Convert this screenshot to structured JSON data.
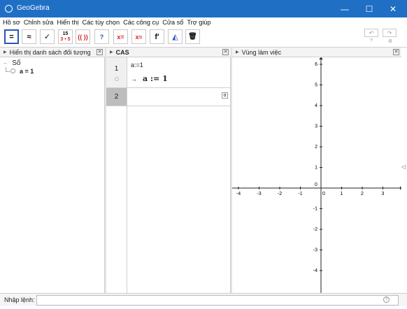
{
  "window": {
    "title": "GeoGebra",
    "minimize": "—",
    "maximize": "☐",
    "close": "✕"
  },
  "menu": [
    "Hồ sơ",
    "Chỉnh sửa",
    "Hiển thị",
    "Các tùy chọn",
    "Các công cụ",
    "Cửa sổ",
    "Trợ giúp"
  ],
  "toolbar": {
    "tools": [
      {
        "name": "evaluate-tool",
        "label": "="
      },
      {
        "name": "numeric-tool",
        "label": "≈"
      },
      {
        "name": "keep-input-tool",
        "label": "✓"
      },
      {
        "name": "factor-tool",
        "label": "15"
      },
      {
        "name": "expand-tool",
        "label": "(( ))"
      },
      {
        "name": "substitute-tool",
        "label": "?"
      },
      {
        "name": "solve-tool",
        "label": "x="
      },
      {
        "name": "solve-numeric-tool",
        "label": "x≈"
      },
      {
        "name": "derivative-tool",
        "label": "f′"
      },
      {
        "name": "probability-tool",
        "label": "◭"
      },
      {
        "name": "delete-tool",
        "label": "🗑"
      }
    ],
    "factor_sub": "3 • 5",
    "undo": "↶",
    "redo": "↷",
    "help": "?",
    "settings": "⚙"
  },
  "algebra": {
    "header": "Hiển thị danh sách đối tượng",
    "group": "Số",
    "item": "a = 1"
  },
  "cas": {
    "header": "CAS",
    "rows": [
      {
        "num": "1",
        "input": "a:=1",
        "output": "a := 1",
        "arrow": "→"
      },
      {
        "num": "2"
      }
    ],
    "alpha": "α"
  },
  "graphics": {
    "header": "Vùng làm việc",
    "x_ticks": [
      "-4",
      "-3",
      "-2",
      "-1",
      "0",
      "1",
      "2",
      "3"
    ],
    "y_ticks": [
      "6",
      "5",
      "4",
      "3",
      "2",
      "1",
      "-1",
      "-2",
      "-3",
      "-4"
    ],
    "origin": "0"
  },
  "input_bar": {
    "label": "Nhập lệnh:",
    "value": ""
  }
}
